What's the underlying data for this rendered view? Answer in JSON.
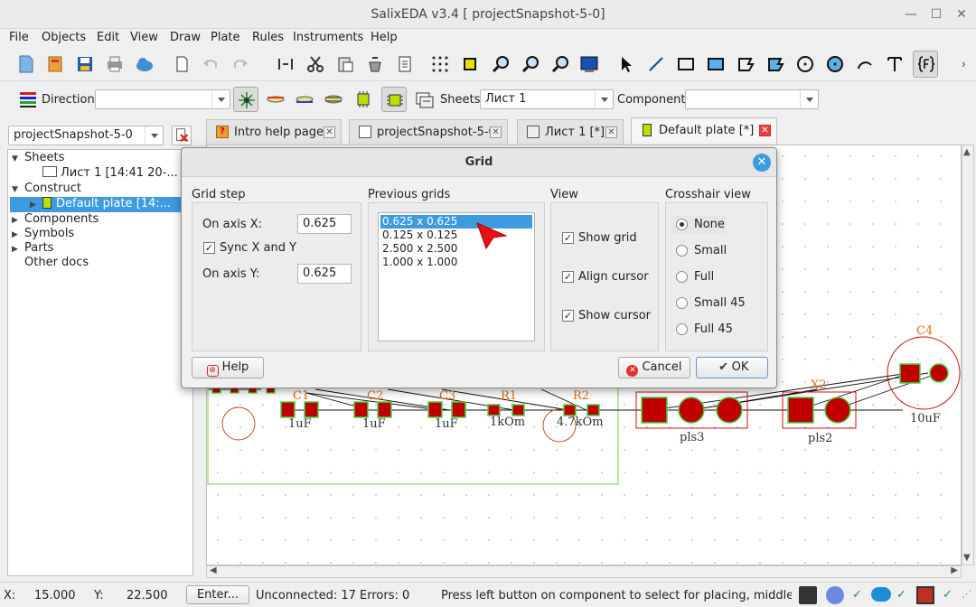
{
  "window": {
    "title": "SalixEDA v3.4 [ projectSnapshot-5-0]"
  },
  "menu": [
    "File",
    "Objects",
    "Edit",
    "View",
    "Draw",
    "Plate",
    "Rules",
    "Instruments",
    "Help"
  ],
  "toolbar2": {
    "direction_label": "Direction:",
    "direction_value": "",
    "sheets_label": "Sheets:",
    "sheets_value": "Лист 1",
    "component_label": "Component:",
    "component_value": ""
  },
  "project_selector": {
    "value": "projectSnapshot-5-0"
  },
  "tree": [
    {
      "label": "Sheets",
      "level": 0,
      "expander": "▼"
    },
    {
      "label": "Лист 1 [14:41 20-...",
      "level": 2,
      "expander": ""
    },
    {
      "label": "Construct",
      "level": 0,
      "expander": "▼"
    },
    {
      "label": "Default plate [14:...",
      "level": 1,
      "expander": "▶",
      "selected": true
    },
    {
      "label": "Components",
      "level": 0,
      "expander": "▶"
    },
    {
      "label": "Symbols",
      "level": 0,
      "expander": "▶"
    },
    {
      "label": "Parts",
      "level": 0,
      "expander": "▶"
    },
    {
      "label": "Other docs",
      "level": 0,
      "expander": ""
    }
  ],
  "tabs": [
    {
      "label": "Intro help page",
      "icon": "help-page-icon"
    },
    {
      "label": "projectSnapshot-5-0",
      "icon": "project-icon"
    },
    {
      "label": "Лист 1 [*]",
      "icon": "schematic-sheet-icon"
    },
    {
      "label": "Default plate [*]",
      "icon": "pcb-plate-icon",
      "active": true
    }
  ],
  "canvas_labels": {
    "c1": "C1",
    "c1_val": "1uF",
    "c2": "C2",
    "c2_val": "1uF",
    "c3": "C3",
    "c3_val": "1uF",
    "r1": "R1",
    "r1_val": "1kOm",
    "r2": "R2",
    "r2_val": "4.7kOm",
    "pls3": "pls3",
    "x2": "X2",
    "pls2": "pls2",
    "c4": "C4",
    "c4_val": "10uF"
  },
  "dialog": {
    "title": "Grid",
    "grid_step": {
      "title": "Grid step",
      "axis_x_label": "On axis X:",
      "axis_x_value": "0.625",
      "sync_label": "Sync X and Y",
      "sync_checked": true,
      "axis_y_label": "On axis Y:",
      "axis_y_value": "0.625"
    },
    "previous_grids": {
      "title": "Previous grids",
      "items": [
        "0.625 x 0.625",
        "0.125 x 0.125",
        "2.500 x 2.500",
        "1.000 x 1.000"
      ],
      "selected_index": 0
    },
    "view": {
      "title": "View",
      "items": [
        {
          "label": "Show grid",
          "checked": true
        },
        {
          "label": "Align cursor",
          "checked": true
        },
        {
          "label": "Show cursor",
          "checked": true
        }
      ]
    },
    "crosshair": {
      "title": "Crosshair view",
      "options": [
        "None",
        "Small",
        "Full",
        "Small 45",
        "Full 45"
      ],
      "selected_index": 0
    },
    "help_label": "Help",
    "cancel_label": "Cancel",
    "ok_label": "OK"
  },
  "status": {
    "x_label": "X:",
    "x_value": "15.000",
    "y_label": "Y:",
    "y_value": "22.500",
    "enter_label": "Enter...",
    "unconnected": "Unconnected: 17  Errors: 0",
    "hint": "Press left button on component to select for placing, middle butto"
  },
  "colors": {
    "accent": "#3d9be0",
    "pad": "#c00000",
    "pad_outline": "#44d444",
    "silk": "#e07010",
    "board_outline": "#88dd55"
  }
}
